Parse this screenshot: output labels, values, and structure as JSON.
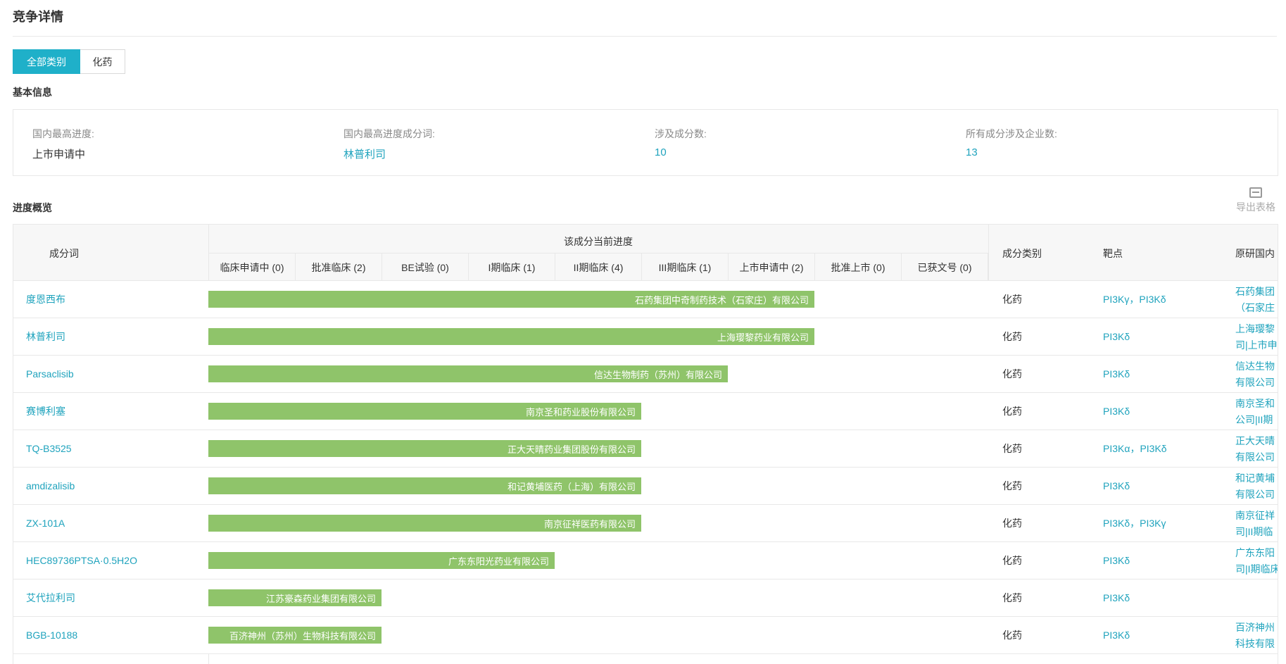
{
  "page": {
    "title": "竞争详情"
  },
  "tabs": [
    {
      "label": "全部类别",
      "active": true
    },
    {
      "label": "化药",
      "active": false
    }
  ],
  "basic_info": {
    "section_title": "基本信息",
    "items": [
      {
        "label": "国内最高进度:",
        "value": "上市申请中",
        "is_link": false
      },
      {
        "label": "国内最高进度成分词:",
        "value": "林普利司",
        "is_link": true
      },
      {
        "label": "涉及成分数:",
        "value": "10",
        "is_link": true
      },
      {
        "label": "所有成分涉及企业数:",
        "value": "13",
        "is_link": true
      }
    ]
  },
  "progress": {
    "section_title": "进度概览",
    "export_label": "导出表格",
    "columns": {
      "ingredient": "成分词",
      "progress_group": "该成分当前进度",
      "category": "成分类别",
      "target": "靶点",
      "original": "原研国内"
    },
    "stages": [
      "临床申请中 (0)",
      "批准临床 (2)",
      "BE试验 (0)",
      "I期临床 (1)",
      "II期临床 (4)",
      "III期临床 (1)",
      "上市申请中 (2)",
      "批准上市 (0)",
      "已获文号 (0)"
    ],
    "rows": [
      {
        "name": "度恩西布",
        "company": "石药集团中奇制药技术（石家庄）有限公司",
        "stage_level": 7,
        "category": "化药",
        "target": "PI3Kγ，PI3Kδ",
        "original": [
          "石药集团",
          "（石家庄"
        ]
      },
      {
        "name": "林普利司",
        "company": "上海璎黎药业有限公司",
        "stage_level": 7,
        "category": "化药",
        "target": "PI3Kδ",
        "original": [
          "上海璎黎",
          "司|上市申"
        ]
      },
      {
        "name": "Parsaclisib",
        "company": "信达生物制药（苏州）有限公司",
        "stage_level": 6,
        "category": "化药",
        "target": "PI3Kδ",
        "original": [
          "信达生物",
          "有限公司"
        ]
      },
      {
        "name": "赛博利塞",
        "company": "南京圣和药业股份有限公司",
        "stage_level": 5,
        "category": "化药",
        "target": "PI3Kδ",
        "original": [
          "南京圣和",
          "公司|II期"
        ]
      },
      {
        "name": "TQ-B3525",
        "company": "正大天晴药业集团股份有限公司",
        "stage_level": 5,
        "category": "化药",
        "target": "PI3Kα，PI3Kδ",
        "original": [
          "正大天晴",
          "有限公司"
        ]
      },
      {
        "name": "amdizalisib",
        "company": "和记黄埔医药（上海）有限公司",
        "stage_level": 5,
        "category": "化药",
        "target": "PI3Kδ",
        "original": [
          "和记黄埔",
          "有限公司"
        ]
      },
      {
        "name": "ZX-101A",
        "company": "南京征祥医药有限公司",
        "stage_level": 5,
        "category": "化药",
        "target": "PI3Kδ，PI3Kγ",
        "original": [
          "南京征祥",
          "司|II期临"
        ]
      },
      {
        "name": "HEC89736PTSA·0.5H2O",
        "company": "广东东阳光药业有限公司",
        "stage_level": 4,
        "category": "化药",
        "target": "PI3Kδ",
        "original": [
          "广东东阳",
          "司|I期临床"
        ]
      },
      {
        "name": "艾代拉利司",
        "company": "江苏豪森药业集团有限公司",
        "stage_level": 2,
        "category": "化药",
        "target": "PI3Kδ",
        "original": [
          "",
          ""
        ]
      },
      {
        "name": "BGB-10188",
        "company": "百济神州（苏州）生物科技有限公司",
        "stage_level": 2,
        "category": "化药",
        "target": "PI3Kδ",
        "original": [
          "百济神州",
          "科技有限"
        ]
      }
    ]
  },
  "colors": {
    "accent": "#1fb0c9",
    "link": "#1fa3bd",
    "bar": "#8fc46a",
    "header_bg": "#f7f7f7",
    "border": "#e8e8e8"
  }
}
